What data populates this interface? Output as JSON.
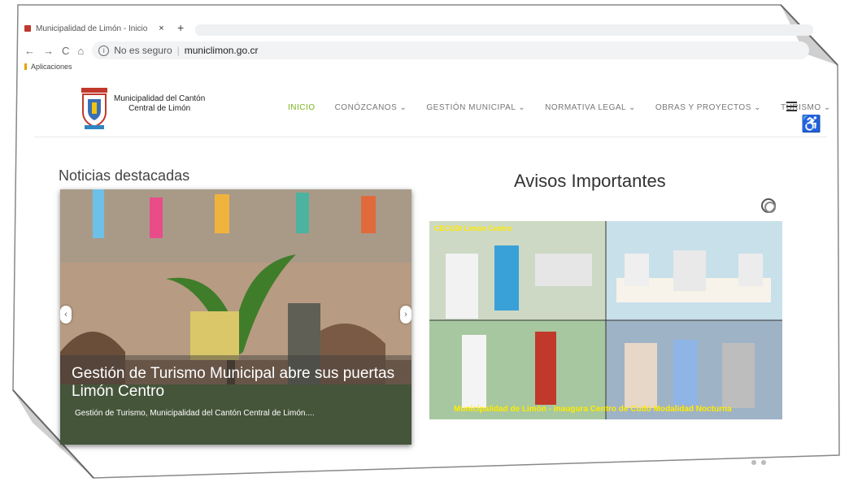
{
  "browser": {
    "tab_title": "Municipalidad de Limón - Inicio",
    "tab_close": "×",
    "new_tab": "+",
    "insecure_label": "No es seguro",
    "url": "municlimon.go.cr",
    "bookmark_label": "Aplicaciones"
  },
  "site": {
    "org_line1": "Municipalidad del Cantón",
    "org_line2": "Central de Limón",
    "menu": [
      {
        "label": "INICIO"
      },
      {
        "label": "CONÓZCANOS ⌄"
      },
      {
        "label": "GESTIÓN MUNICIPAL ⌄"
      },
      {
        "label": "NORMATIVA LEGAL ⌄"
      },
      {
        "label": "OBRAS Y PROYECTOS ⌄"
      },
      {
        "label": "TURISMO ⌄"
      }
    ]
  },
  "news": {
    "heading": "Noticias destacadas",
    "slide_title": "Gestión de Turismo Municipal abre sus puertas Limón Centro",
    "slide_text": "Gestión de Turismo, Municipalidad del Cantón Central de Limón....",
    "prev": "‹",
    "next": "›"
  },
  "avisos": {
    "heading": "Avisos Importantes",
    "photo_tag": "CECUDI Limón Centro",
    "photo_caption": "Municipalidad de Limón - inaugura Centro de Cudo Modalidad Nocturna"
  },
  "colors": {
    "active_menu": "#7cb518",
    "caption_text": "#ffeb00"
  },
  "icons": {
    "accessibility": "♿",
    "hamburger": "hamburger-icon"
  }
}
